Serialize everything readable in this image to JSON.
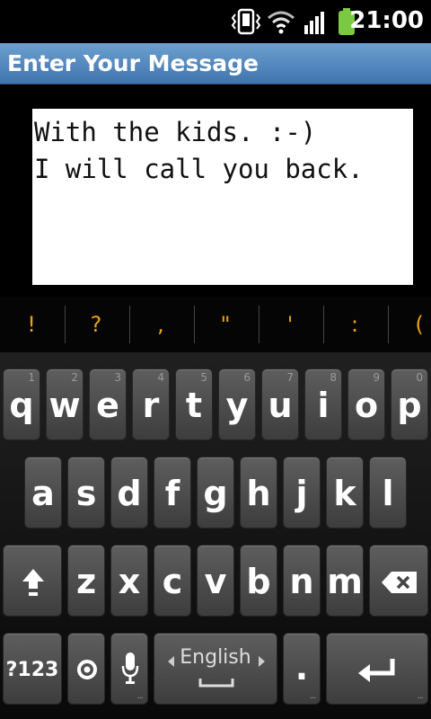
{
  "status_bar": {
    "time": "21:00",
    "icons": [
      "vibrate-icon",
      "wifi-icon",
      "signal-icon",
      "battery-icon"
    ],
    "battery_color": "#7ac943"
  },
  "title_bar": {
    "title": "Enter Your Message",
    "color": "#4a7fb8"
  },
  "message": {
    "lines": [
      "With the kids. :-)",
      "I will call you back."
    ]
  },
  "suggestions": [
    "!",
    "?",
    ",",
    "\"",
    "'",
    ":",
    "("
  ],
  "keyboard": {
    "row1": [
      {
        "key": "q",
        "hint": "1"
      },
      {
        "key": "w",
        "hint": "2"
      },
      {
        "key": "e",
        "hint": "3"
      },
      {
        "key": "r",
        "hint": "4"
      },
      {
        "key": "t",
        "hint": "5"
      },
      {
        "key": "y",
        "hint": "6"
      },
      {
        "key": "u",
        "hint": "7"
      },
      {
        "key": "i",
        "hint": "8"
      },
      {
        "key": "o",
        "hint": "9"
      },
      {
        "key": "p",
        "hint": "0"
      }
    ],
    "row2": [
      "a",
      "s",
      "d",
      "f",
      "g",
      "h",
      "j",
      "k",
      "l"
    ],
    "row3": [
      "z",
      "x",
      "c",
      "v",
      "b",
      "n",
      "m"
    ],
    "symbols_label": "?123",
    "language_label": "English",
    "period_label": ".",
    "more_dots": "..."
  }
}
